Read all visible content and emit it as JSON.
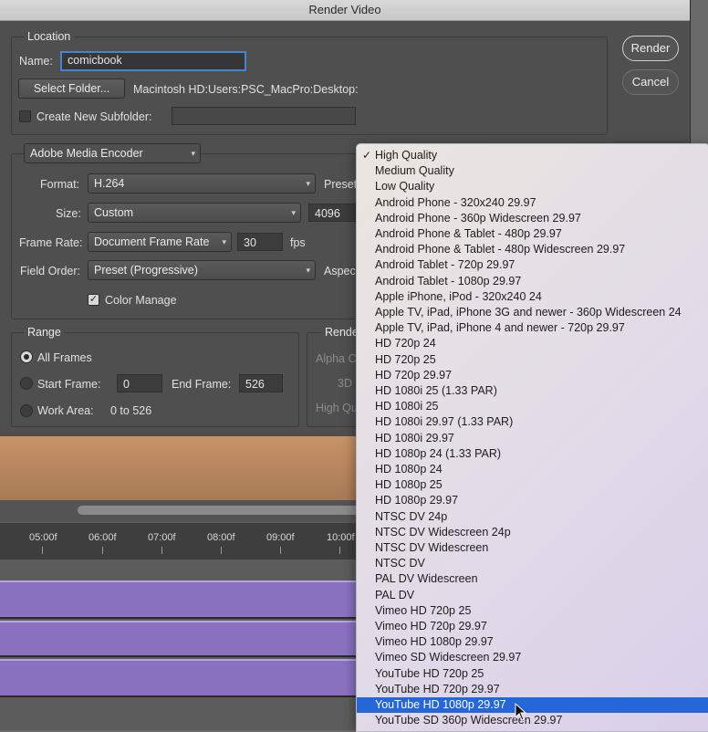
{
  "window": {
    "title": "Render Video"
  },
  "location": {
    "group_label": "Location",
    "name_label": "Name:",
    "name_value": "comicbook",
    "select_folder_label": "Select Folder...",
    "folder_path": "Macintosh HD:Users:PSC_MacPro:Desktop:",
    "create_subfolder_label": "Create New Subfolder:",
    "create_subfolder_checked": false,
    "subfolder_value": ""
  },
  "buttons": {
    "render": "Render",
    "cancel": "Cancel"
  },
  "encoder": {
    "selected": "Adobe Media Encoder",
    "format_label": "Format:",
    "format_value": "H.264",
    "preset_label": "Preset",
    "size_label": "Size:",
    "size_value": "Custom",
    "size_width": "4096",
    "frame_rate_label": "Frame Rate:",
    "frame_rate_value": "Document Frame Rate",
    "fps_value": "30",
    "fps_label": "fps",
    "field_order_label": "Field Order:",
    "field_order_value": "Preset (Progressive)",
    "aspect_label": "Aspect",
    "color_manage_label": "Color Manage",
    "color_manage_checked": true
  },
  "range": {
    "group_label": "Range",
    "all_frames_label": "All Frames",
    "start_frame_label": "Start Frame:",
    "start_frame_value": "0",
    "end_frame_label": "End Frame:",
    "end_frame_value": "526",
    "work_area_label": "Work Area:",
    "work_area_value": "0 to 526",
    "selected": "All Frames"
  },
  "render_options": {
    "group_label": "Rende",
    "alpha_label": "Alpha C",
    "threed_label": "3D",
    "high_quality_label": "High Qu"
  },
  "timeline": {
    "ticks": [
      "05:00f",
      "06:00f",
      "07:00f",
      "08:00f",
      "09:00f",
      "10:00f"
    ],
    "track_color": "#8a72c0"
  },
  "preset_menu": {
    "items": [
      "High Quality",
      "Medium Quality",
      "Low Quality",
      "Android Phone - 320x240 29.97",
      "Android Phone - 360p Widescreen 29.97",
      "Android Phone & Tablet - 480p 29.97",
      "Android Phone & Tablet - 480p Widescreen 29.97",
      "Android Tablet - 720p 29.97",
      "Android Tablet - 1080p 29.97",
      "Apple iPhone, iPod - 320x240 24",
      "Apple TV, iPad, iPhone 3G and newer - 360p Widescreen 24",
      "Apple TV, iPad, iPhone 4 and newer - 720p 29.97",
      "HD 720p 24",
      "HD 720p 25",
      "HD 720p 29.97",
      "HD 1080i 25 (1.33 PAR)",
      "HD 1080i 25",
      "HD 1080i 29.97 (1.33 PAR)",
      "HD 1080i 29.97",
      "HD 1080p 24 (1.33 PAR)",
      "HD 1080p 24",
      "HD 1080p 25",
      "HD 1080p 29.97",
      "NTSC DV 24p",
      "NTSC DV Widescreen 24p",
      "NTSC DV Widescreen",
      "NTSC DV",
      "PAL DV Widescreen",
      "PAL DV",
      "Vimeo HD 720p 25",
      "Vimeo HD 720p 29.97",
      "Vimeo HD 1080p 29.97",
      "Vimeo SD Widescreen 29.97",
      "YouTube HD 720p 25",
      "YouTube HD 720p 29.97",
      "YouTube HD 1080p 29.97",
      "YouTube SD 360p Widescreen 29.97"
    ],
    "checked_item": "High Quality",
    "highlighted_item": "YouTube HD 1080p 29.97",
    "checkmark": "✓",
    "highlight_color": "#2566d9"
  }
}
